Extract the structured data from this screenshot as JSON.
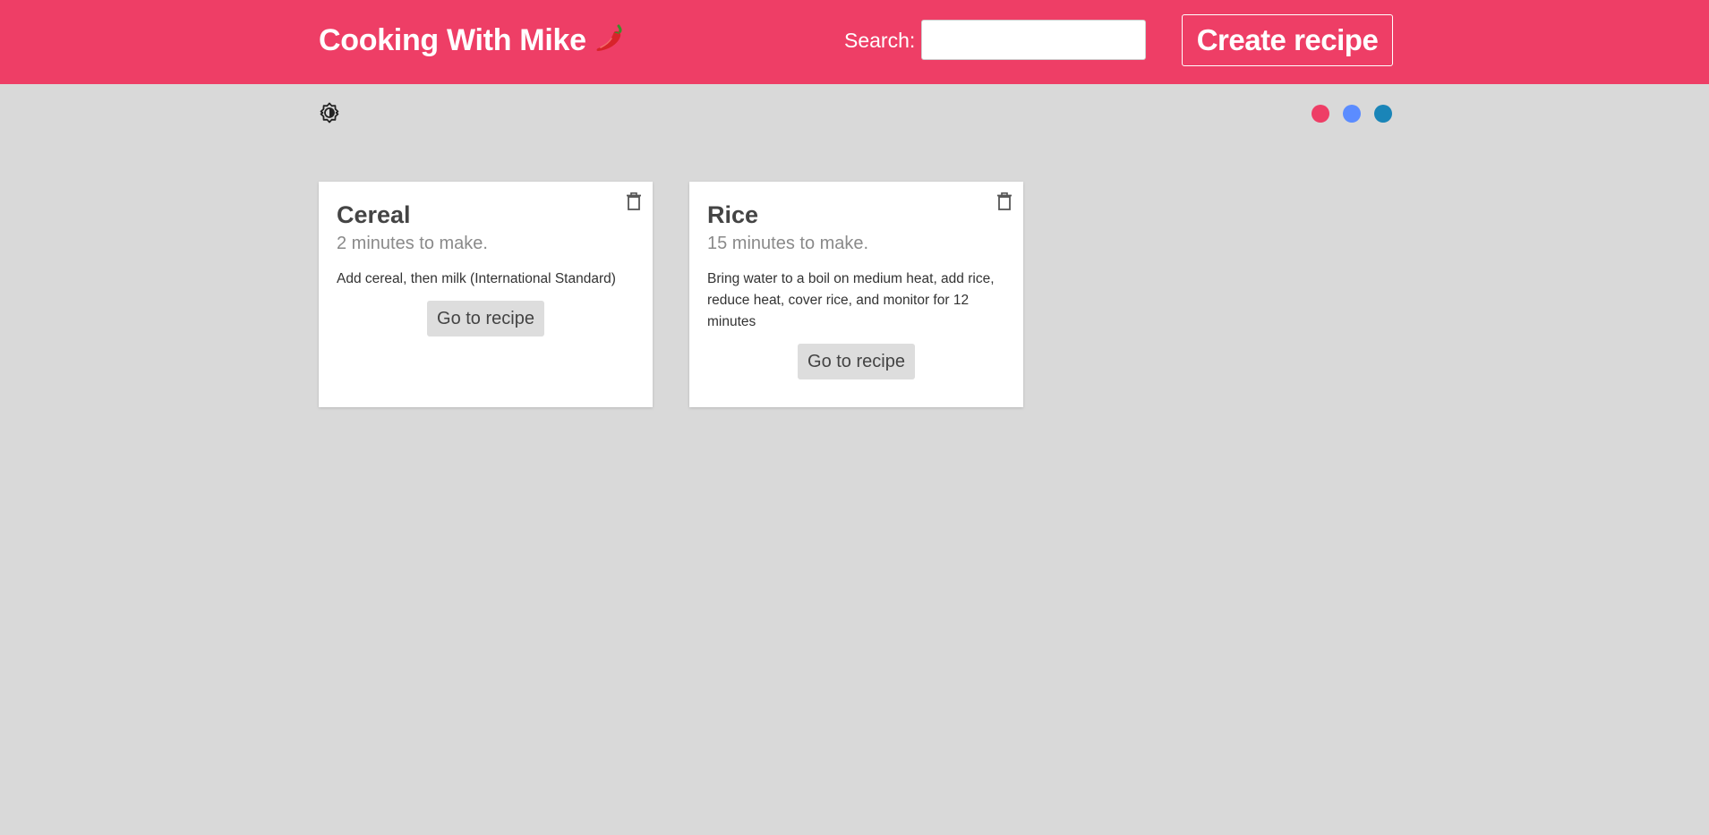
{
  "header": {
    "title": "Cooking With Mike",
    "title_icon": "chili-pepper-icon",
    "search_label": "Search:",
    "search_value": "",
    "search_placeholder": "",
    "create_label": "Create recipe",
    "background_color": "#ee3e66"
  },
  "toolbar": {
    "theme_toggle_icon": "brightness-icon",
    "color_options": [
      {
        "name": "pink",
        "color": "#ee3e66"
      },
      {
        "name": "blue",
        "color": "#5b8cff"
      },
      {
        "name": "teal",
        "color": "#1a85b8"
      }
    ]
  },
  "recipes": [
    {
      "title": "Cereal",
      "time": "2 minutes to make.",
      "description": "Add cereal, then milk (International Standard)",
      "button_label": "Go to recipe",
      "delete_icon": "trash-icon"
    },
    {
      "title": "Rice",
      "time": "15 minutes to make.",
      "description": "Bring water to a boil on medium heat, add rice, reduce heat, cover rice, and monitor for 12 minutes",
      "button_label": "Go to recipe",
      "delete_icon": "trash-icon"
    }
  ]
}
